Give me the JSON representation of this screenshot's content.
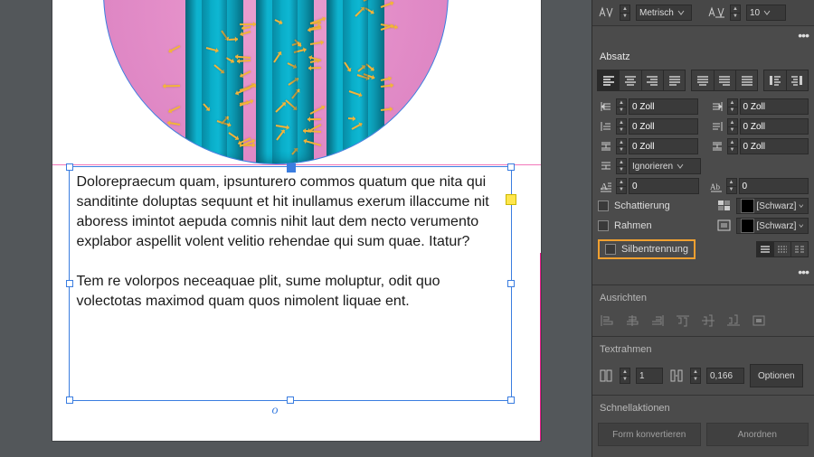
{
  "kerning": {
    "method_dropdown": "Metrisch",
    "tracking_value": "10"
  },
  "panel": {
    "title": "Absatz",
    "indents": {
      "left": "0 Zoll",
      "right": "0 Zoll",
      "first_line": "0 Zoll",
      "last_line": "0 Zoll",
      "space_before": "0 Zoll",
      "space_after": "0 Zoll",
      "auto_leading": "Ignorieren"
    },
    "dropcap": {
      "lines": "0",
      "chars": "0"
    },
    "shading": {
      "label": "Schattierung",
      "color_name": "[Schwarz]"
    },
    "border": {
      "label": "Rahmen",
      "color_name": "[Schwarz]"
    },
    "hyphenation": {
      "label": "Silbentrennung"
    }
  },
  "align_section": {
    "title": "Ausrichten"
  },
  "textframe_section": {
    "title": "Textrahmen",
    "columns": "1",
    "gutter": "0,166",
    "options_btn": "Optionen"
  },
  "quickactions": {
    "title": "Schnellaktionen",
    "btn1": "Form konvertieren",
    "btn2": "Anordnen"
  },
  "document": {
    "paragraph1": "Dolorepraecum quam, ipsunturero commos quatum que nita qui sanditinte doluptas sequunt et hit inullamus exerum illaccume nit aboress imintot aepuda comnis nihit laut dem necto verumento explabor aspellit volent velitio rehendae qui sum quae. Itatur?",
    "paragraph2": "Tem re volorpos neceaquae plit, sume moluptur, odit quo volectotas maximod quam quos nimolent liquae ent."
  }
}
